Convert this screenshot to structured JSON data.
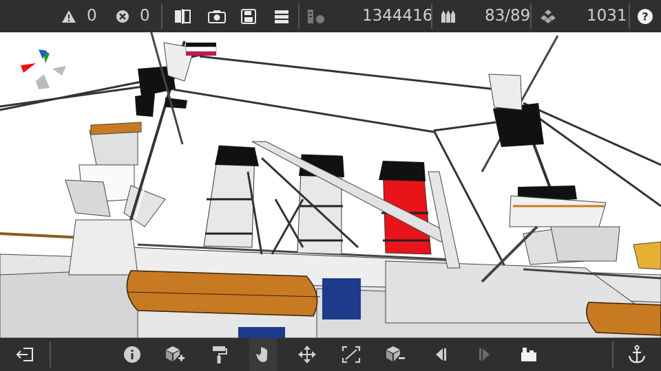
{
  "top": {
    "warnings_count": "0",
    "errors_count": "0",
    "poly_count": "1344416",
    "ammo_count": "83/89",
    "parts_count": "1031"
  },
  "icons": {
    "warning": "warning-icon",
    "error": "error-icon",
    "split_view": "split-view-icon",
    "camera": "camera-icon",
    "save": "save-icon",
    "menu": "menu-icon",
    "stats": "stats-icon",
    "ammo": "ammo-icon",
    "parts": "parts-icon",
    "help": "help-icon",
    "exit": "exit-icon",
    "info": "info-icon",
    "add_block": "add-block-icon",
    "paint": "paint-roller-icon",
    "hand": "hand-icon",
    "move": "move-icon",
    "resize": "resize-icon",
    "remove_block": "remove-block-icon",
    "undo": "undo-icon",
    "redo": "redo-icon",
    "build": "build-icon",
    "anchor": "anchor-icon"
  },
  "colors": {
    "toolbar_bg": "#2f2f2f",
    "funnel_red": "#e8141a",
    "lifeboat_orange": "#c87a22",
    "hull_white": "#f2f2f2",
    "panel_blue": "#1e3a8a"
  }
}
